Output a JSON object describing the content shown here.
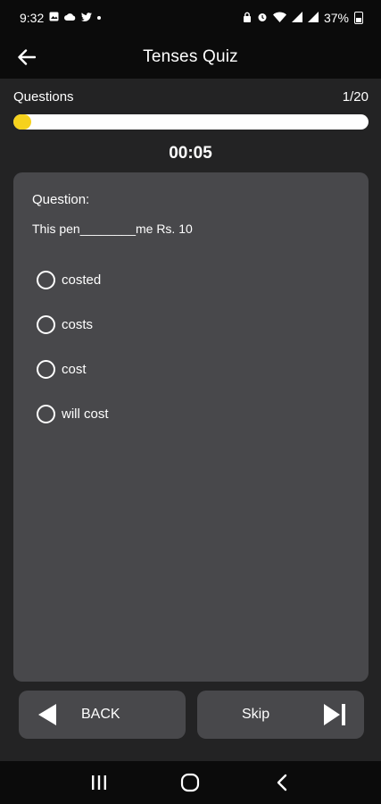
{
  "status_bar": {
    "time": "9:32",
    "battery": "37%"
  },
  "header": {
    "title": "Tenses Quiz",
    "back_icon": "arrow-left-icon"
  },
  "progress": {
    "label": "Questions",
    "counter": "1/20",
    "fraction": 0.05,
    "fill_color": "#f6d21c",
    "track_color": "#ffffff"
  },
  "timer": "00:05",
  "question": {
    "heading": "Question:",
    "text": "This pen________me Rs. 10",
    "options": [
      {
        "label": "costed"
      },
      {
        "label": "costs"
      },
      {
        "label": "cost"
      },
      {
        "label": "will cost"
      }
    ]
  },
  "buttons": {
    "back_label": "BACK",
    "skip_label": "Skip"
  },
  "colors": {
    "background": "#232324",
    "card": "#48484b",
    "bars": "#0b0b0b",
    "accent": "#f6d21c"
  }
}
